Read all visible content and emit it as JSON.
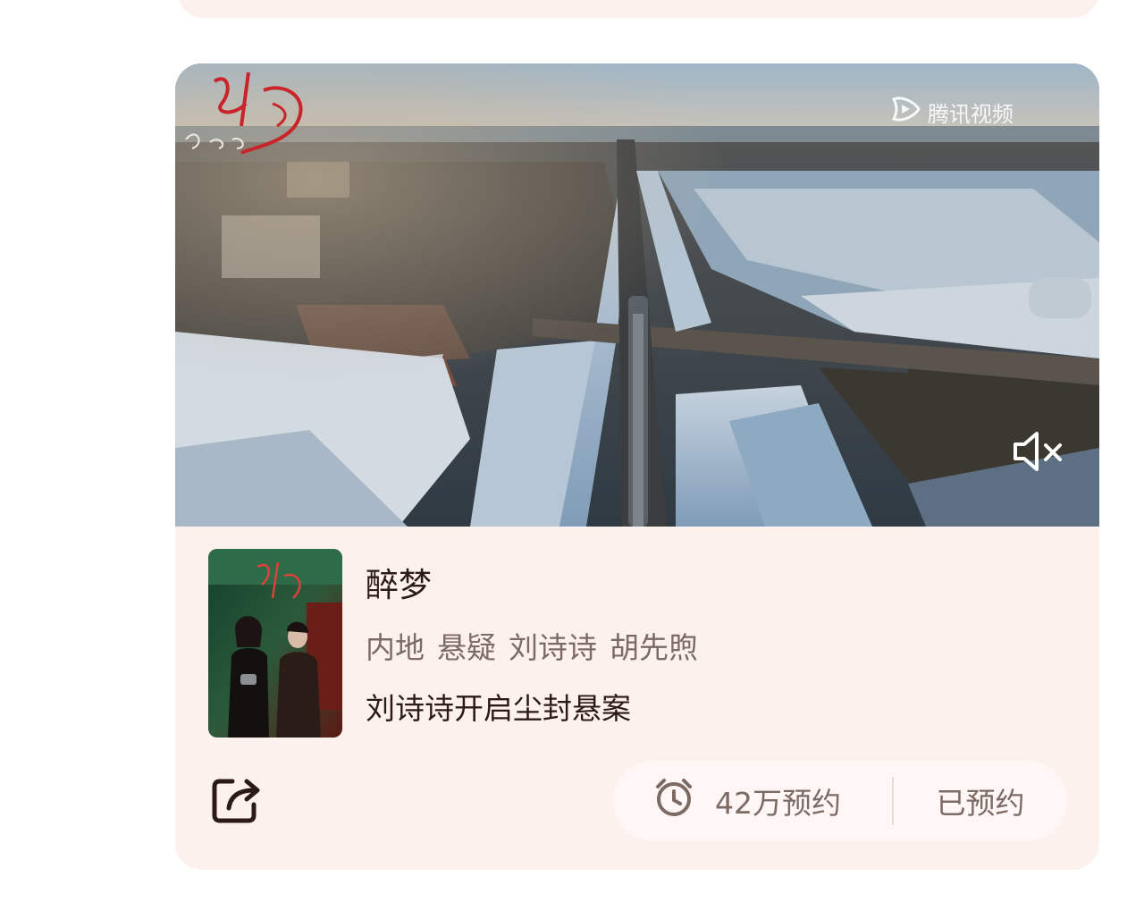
{
  "video": {
    "watermark_text": "腾讯视频",
    "watermark_icon": "tencent-video-logo-icon",
    "title_logo_icon": "drama-title-logo-icon",
    "mute_icon": "speaker-muted-icon"
  },
  "show": {
    "title": "醉梦",
    "tags": [
      "内地",
      "悬疑",
      "刘诗诗",
      "胡先煦"
    ],
    "description": "刘诗诗开启尘封悬案",
    "poster_icon": "poster-image"
  },
  "actions": {
    "share_icon": "share-icon",
    "alarm_icon": "alarm-clock-icon",
    "reserve_count": "42万预约",
    "reserved_label": "已预约"
  },
  "colors": {
    "card_bg": "#fdf1ee",
    "pill_bg": "#fef7f5",
    "primary_text": "#2b1a16",
    "secondary_text": "#7c6a65"
  }
}
